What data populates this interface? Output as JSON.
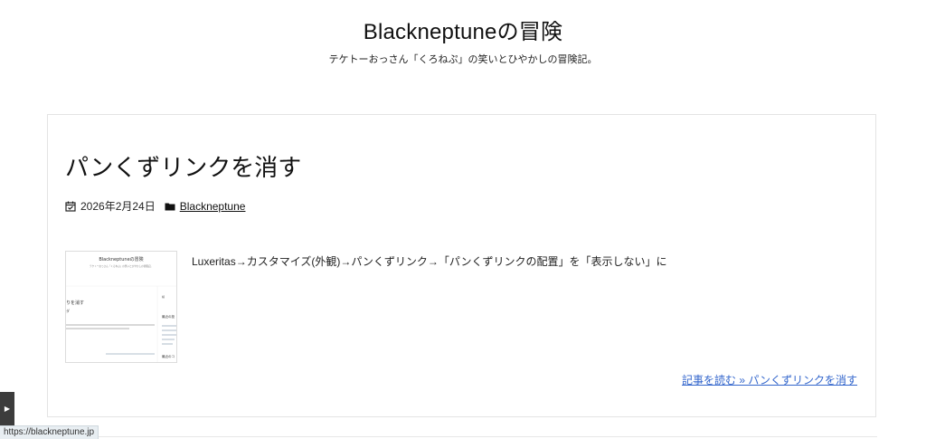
{
  "site": {
    "title": "Blackneptuneの冒険",
    "description": "テケトーおっさん「くろねぷ」の笑いとひやかしの冒険記。"
  },
  "post": {
    "title": "パンくずリンクを消す",
    "date": "2026年2月24日",
    "category": "Blackneptune",
    "excerpt": "Luxeritas→カスタマイズ(外観)→パンくずリンク→「パンくずリンクの配置」を「表示しない」に",
    "read_more": "記事を読む » パンくずリンクを消す"
  },
  "thumbnail": {
    "site_title": "Blackneptuneの冒険",
    "tagline": "テケトーおっさん「くろねぷ」の笑いとひやかしの冒険記。",
    "post_title": "りを消す",
    "side_head": "最近の投",
    "side_head2": "最近のコ"
  },
  "status_bar": {
    "url": "https://blackneptune.jp"
  },
  "colors": {
    "link": "#3366cc",
    "text": "#222222",
    "status_bg": "#e8eef2"
  }
}
